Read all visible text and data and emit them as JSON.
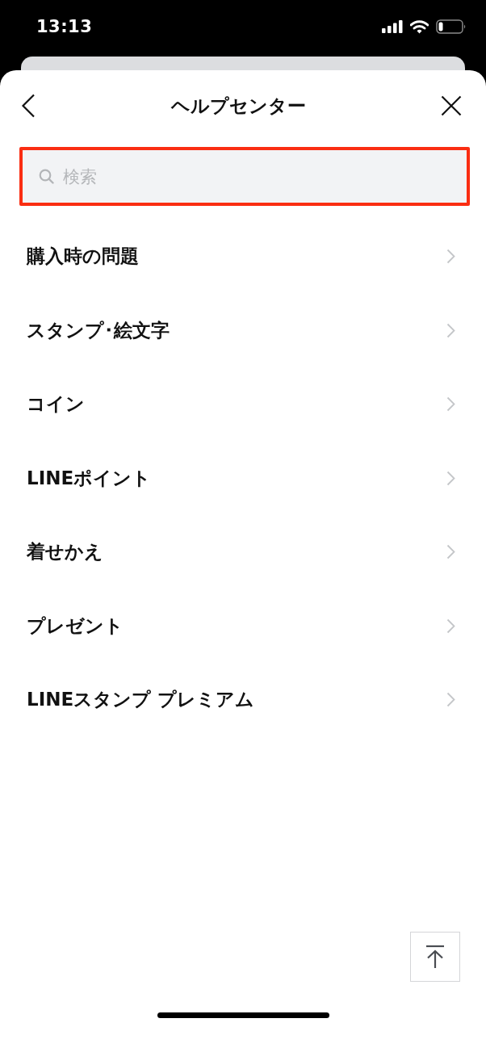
{
  "status_bar": {
    "time": "13:13"
  },
  "header": {
    "title": "ヘルプセンター"
  },
  "search": {
    "placeholder": "検索",
    "highlighted": true
  },
  "items": [
    {
      "label": "購入時の問題"
    },
    {
      "label": "スタンプ･絵文字"
    },
    {
      "label": "コイン"
    },
    {
      "label": "LINEポイント"
    },
    {
      "label": "着せかえ"
    },
    {
      "label": "プレゼント"
    },
    {
      "label": "LINEスタンプ プレミアム"
    }
  ]
}
